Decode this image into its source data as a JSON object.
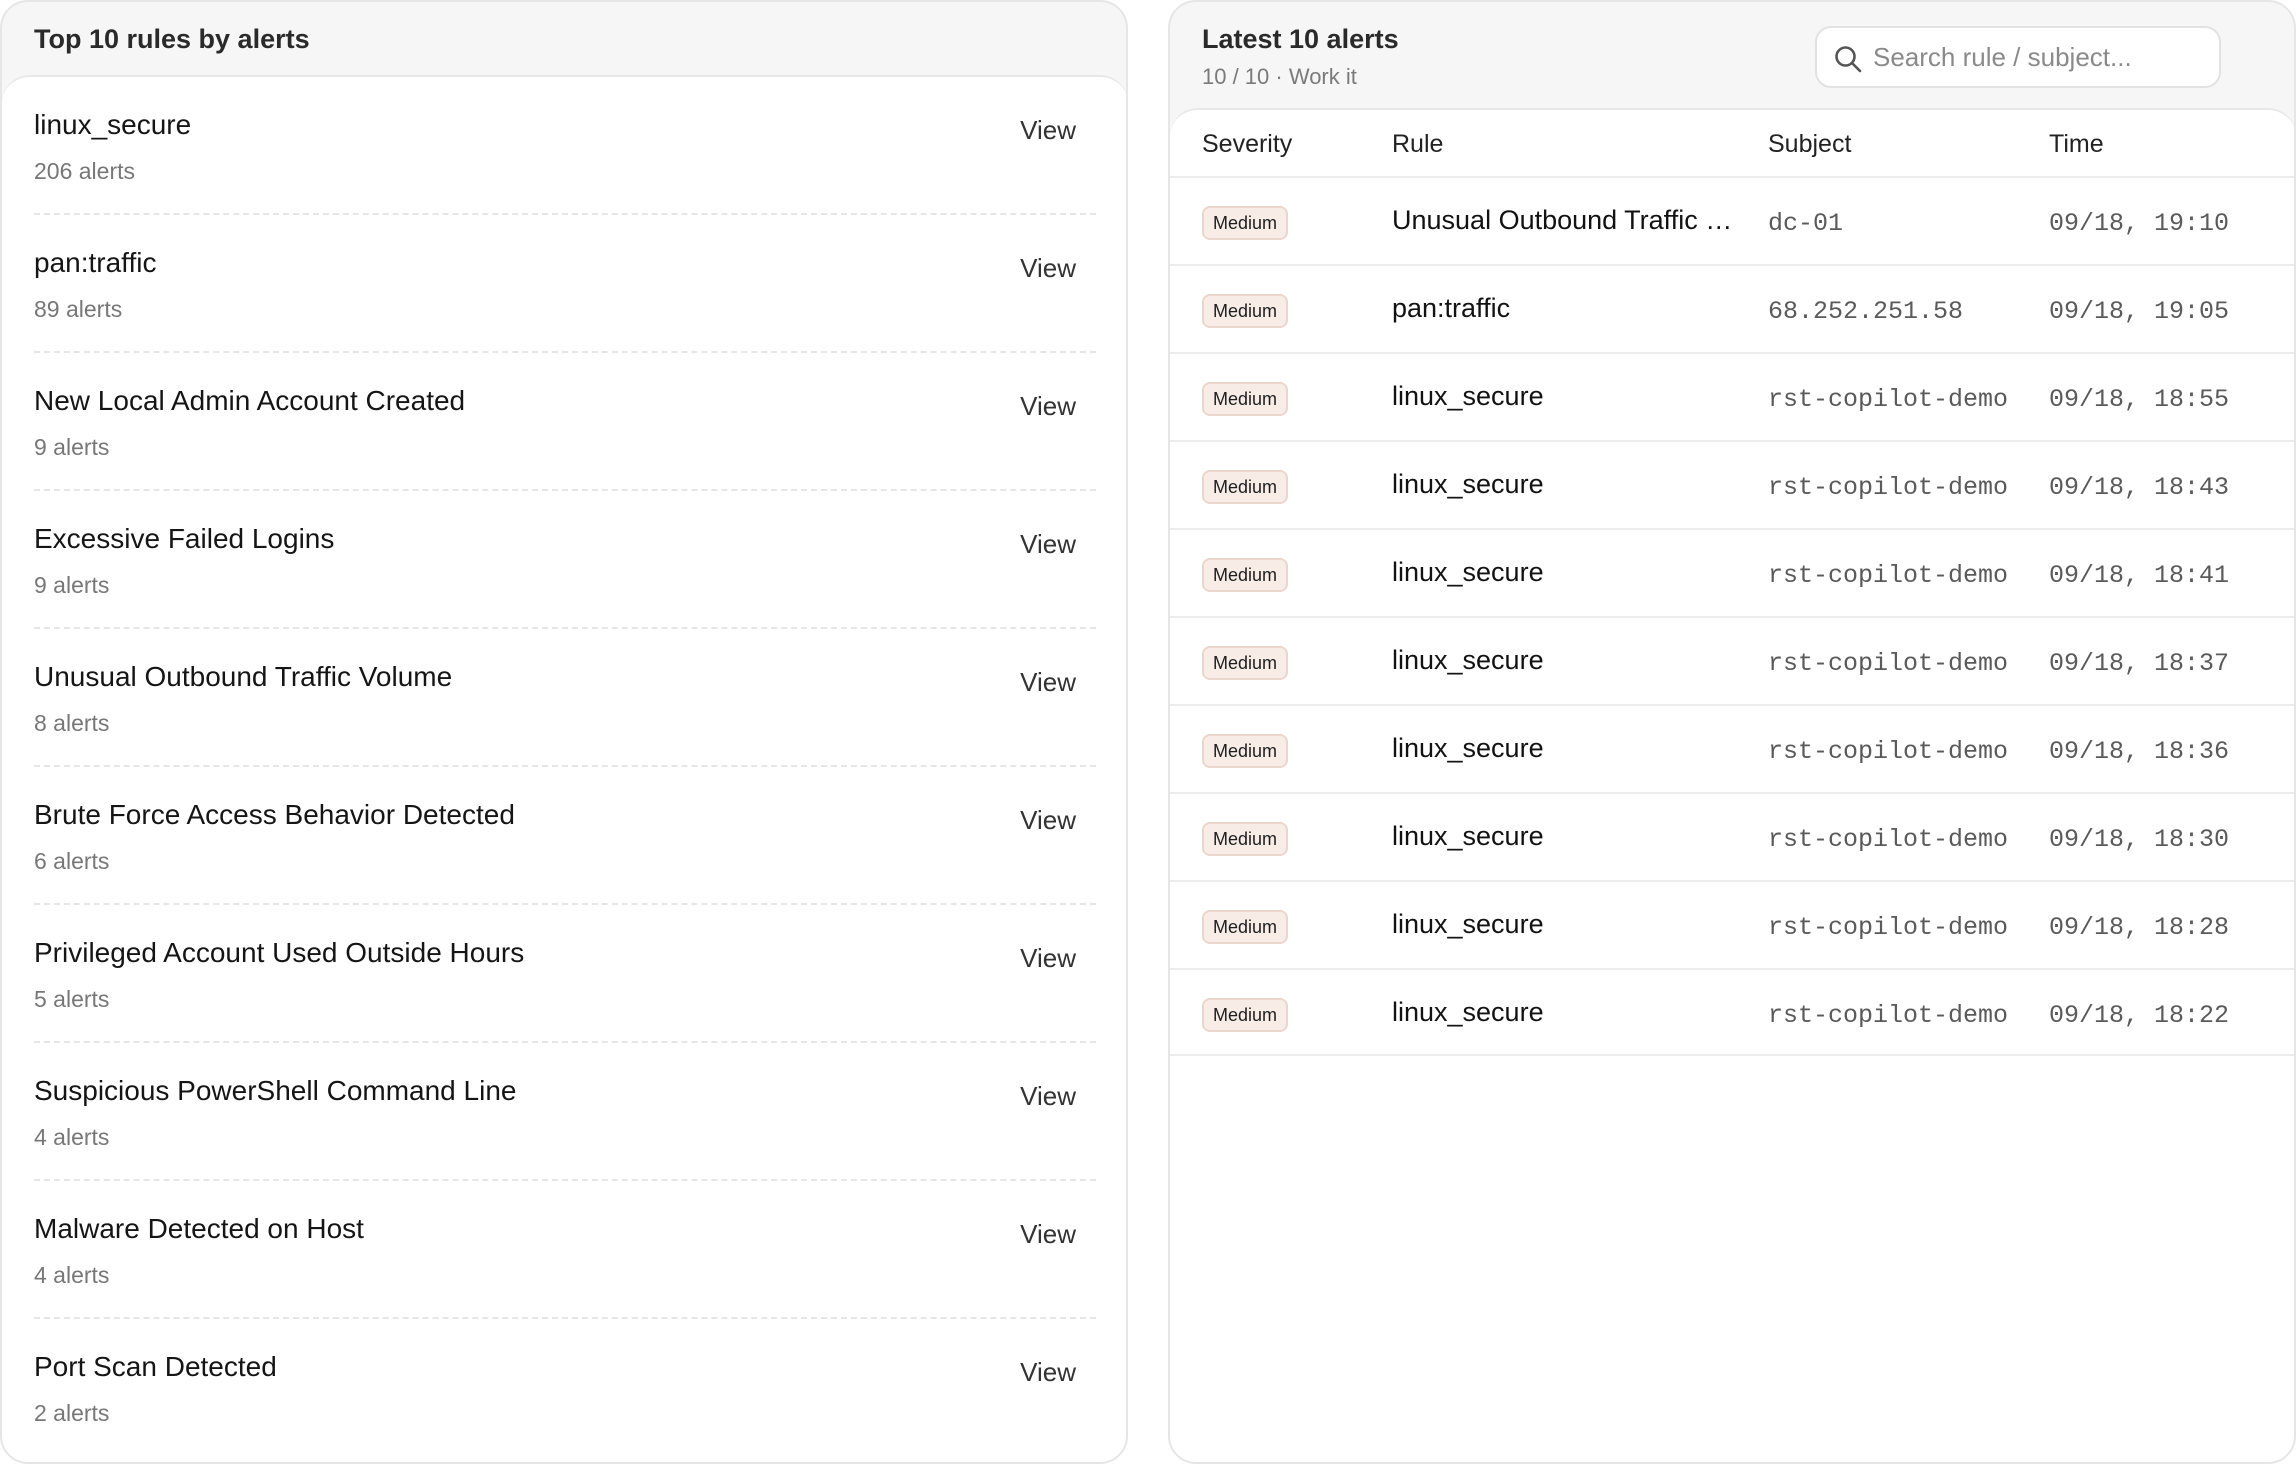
{
  "left": {
    "title": "Top 10 rules by alerts",
    "view_label": "View",
    "rules": [
      {
        "name": "linux_secure",
        "count": "206 alerts"
      },
      {
        "name": "pan:traffic",
        "count": "89 alerts"
      },
      {
        "name": "New Local Admin Account Created",
        "count": "9 alerts"
      },
      {
        "name": "Excessive Failed Logins",
        "count": "9 alerts"
      },
      {
        "name": "Unusual Outbound Traffic Volume",
        "count": "8 alerts"
      },
      {
        "name": "Brute Force Access Behavior Detected",
        "count": "6 alerts"
      },
      {
        "name": "Privileged Account Used Outside Hours",
        "count": "5 alerts"
      },
      {
        "name": "Suspicious PowerShell Command Line",
        "count": "4 alerts"
      },
      {
        "name": "Malware Detected on Host",
        "count": "4 alerts"
      },
      {
        "name": "Port Scan Detected",
        "count": "2 alerts"
      }
    ]
  },
  "right": {
    "title": "Latest 10 alerts",
    "subtitle": "10 / 10 · Work it",
    "search": {
      "placeholder": "Search rule / subject..."
    },
    "columns": {
      "severity": "Severity",
      "rule": "Rule",
      "subject": "Subject",
      "time": "Time"
    },
    "alerts": [
      {
        "severity": "Medium",
        "rule": "Unusual Outbound Traffic Volume",
        "subject": "dc-01",
        "time": "09/18, 19:10"
      },
      {
        "severity": "Medium",
        "rule": "pan:traffic",
        "subject": "68.252.251.58",
        "time": "09/18, 19:05"
      },
      {
        "severity": "Medium",
        "rule": "linux_secure",
        "subject": "rst-copilot-demo",
        "time": "09/18, 18:55"
      },
      {
        "severity": "Medium",
        "rule": "linux_secure",
        "subject": "rst-copilot-demo",
        "time": "09/18, 18:43"
      },
      {
        "severity": "Medium",
        "rule": "linux_secure",
        "subject": "rst-copilot-demo",
        "time": "09/18, 18:41"
      },
      {
        "severity": "Medium",
        "rule": "linux_secure",
        "subject": "rst-copilot-demo",
        "time": "09/18, 18:37"
      },
      {
        "severity": "Medium",
        "rule": "linux_secure",
        "subject": "rst-copilot-demo",
        "time": "09/18, 18:36"
      },
      {
        "severity": "Medium",
        "rule": "linux_secure",
        "subject": "rst-copilot-demo",
        "time": "09/18, 18:30"
      },
      {
        "severity": "Medium",
        "rule": "linux_secure",
        "subject": "rst-copilot-demo",
        "time": "09/18, 18:28"
      },
      {
        "severity": "Medium",
        "rule": "linux_secure",
        "subject": "rst-copilot-demo",
        "time": "09/18, 18:22"
      }
    ]
  }
}
